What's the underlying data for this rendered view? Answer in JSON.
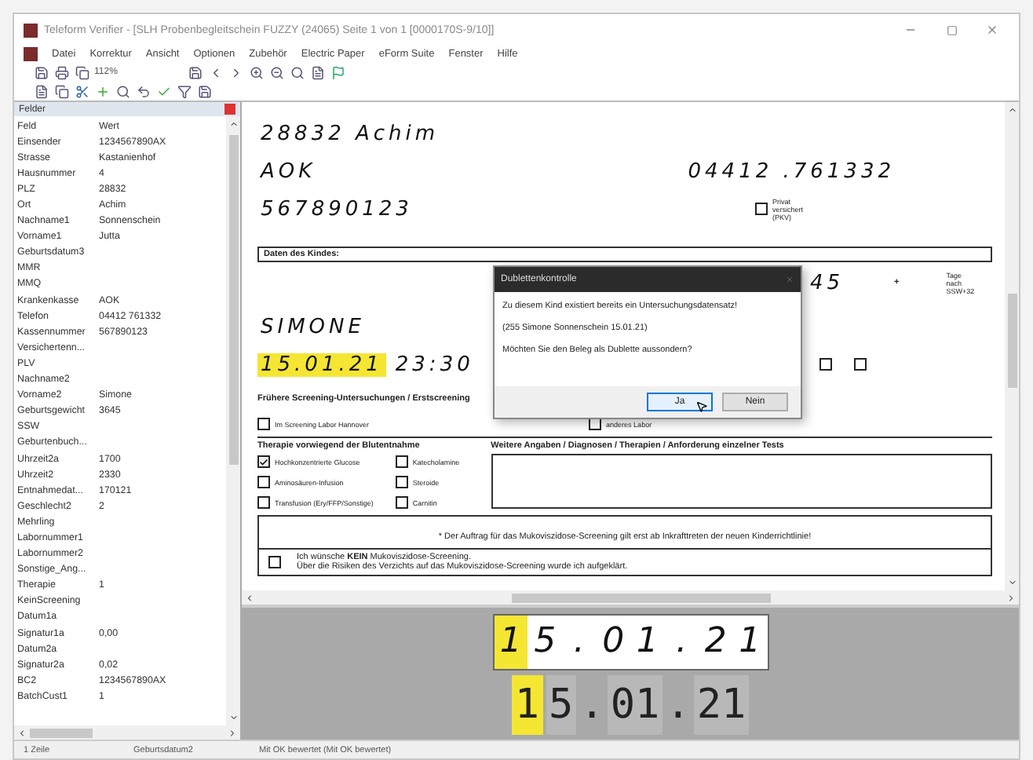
{
  "window": {
    "title": "Teleform Verifier - [SLH Probenbegleitschein FUZZY (24065) Seite 1 von 1 [0000170S-9/10]]"
  },
  "menu": [
    "Datei",
    "Korrektur",
    "Ansicht",
    "Optionen",
    "Zubehör",
    "Electric Paper",
    "eForm Suite",
    "Fenster",
    "Hilfe"
  ],
  "zoom": "112%",
  "fields_panel": {
    "title": "Felder",
    "columns": [
      "Feld",
      "Wert"
    ],
    "rows": [
      {
        "field": "Einsender",
        "value": "1234567890AX"
      },
      {
        "field": "Strasse",
        "value": "Kastanienhof"
      },
      {
        "field": "Hausnummer",
        "value": "4"
      },
      {
        "field": "PLZ",
        "value": "28832"
      },
      {
        "field": "Ort",
        "value": "Achim"
      },
      {
        "field": "Nachname1",
        "value": "Sonnenschein"
      },
      {
        "field": "Vorname1",
        "value": "Jutta"
      },
      {
        "field": "Geburtsdatum3"
      },
      {
        "field": "MMR"
      },
      {
        "field": "MMQ"
      },
      {
        "field": "Krankenkasse",
        "value": "AOK"
      },
      {
        "field": "Telefon",
        "value": "04412 761332"
      },
      {
        "field": "Kassennummer",
        "value": "567890123"
      },
      {
        "field": "Versichertenn..."
      },
      {
        "field": "PLV"
      },
      {
        "field": "Nachname2"
      },
      {
        "field": "Vorname2",
        "value": "Simone"
      },
      {
        "field": "Geburtsgewicht",
        "value": "3645"
      },
      {
        "field": "SSW"
      },
      {
        "field": "Geburtenbuch..."
      },
      {
        "field": "Uhrzeit2a",
        "value": "1700"
      },
      {
        "field": "Uhrzeit2",
        "value": "2330"
      },
      {
        "field": "Entnahmedat...",
        "value": "170121"
      },
      {
        "field": "Geschlecht2",
        "value": "2"
      },
      {
        "field": "Mehrling"
      },
      {
        "field": "Labornummer1"
      },
      {
        "field": "Labornummer2"
      },
      {
        "field": "Sonstige_Ang..."
      },
      {
        "field": "Therapie",
        "value": "1"
      },
      {
        "field": "KeinScreening"
      },
      {
        "field": "Datum1a"
      },
      {
        "field": "Signatur1a",
        "value": "0,00"
      },
      {
        "field": "Datum2a"
      },
      {
        "field": "Signatur2a",
        "value": "0,02"
      },
      {
        "field": "BC2",
        "value": "1234567890AX"
      },
      {
        "field": "BatchCust1",
        "value": "1"
      }
    ]
  },
  "form": {
    "city": "28832 Achim",
    "insurer": "AOK",
    "phone": "04412 .761332",
    "insurance_number": "567890123",
    "private": {
      "label": "Privat versichert (PKV)",
      "checked": false
    },
    "child_section": "Daten des Kindes:",
    "weight_tail": "45",
    "plus": "+",
    "days_label": "Tage nach SSW+32",
    "first_name": "SIMONE",
    "birth_date": "15.01.21",
    "birth_time": "23:30",
    "birth_checkboxes": [
      {
        "checked": false
      },
      {
        "checked": false
      }
    ],
    "earlier_heading": "Frühere Screening-Untersuchungen / Erstscreening",
    "earlier_options": [
      {
        "label": "Im Screening Labor Hannover",
        "checked": false
      },
      {
        "label": "anderes Labor",
        "checked": false
      }
    ],
    "therapy_heading": "Therapie vorwiegend der Blutentnahme",
    "therapies": [
      {
        "label": "Hochkonzentrierte Glucose",
        "checked": true
      },
      {
        "label": "Katecholamine",
        "checked": false
      },
      {
        "label": "Aminosäuren-Infusion",
        "checked": false
      },
      {
        "label": "Steroide",
        "checked": false
      },
      {
        "label": "Transfusion (Ery/FFP/Sonstige)",
        "checked": false
      },
      {
        "label": "Carnitin",
        "checked": false
      }
    ],
    "notes_heading": "Weitere Angaben / Diagnosen / Therapien / Anforderung einzelner Tests",
    "cf_notice": "* Der Auftrag für das Mukoviszidose-Screening gilt erst ab Inkrafttreten der neuen Kinderrichtlinie!",
    "cf_optout": {
      "checked": false,
      "lines": [
        "Ich wünsche **KEIN** Mukoviszidose-Screening.",
        "Über die Risiken des Verzichts auf das Mukoviszidose-Screening wurde ich aufgeklärt."
      ]
    }
  },
  "dialog": {
    "title": "Dublettenkontrolle",
    "lines": [
      "Zu diesem Kind existiert bereits ein Untersuchungsdatensatz!",
      "(255 Simone Sonnenschein 15.01.21)",
      "Möchten Sie den Beleg als Dublette aussondern?"
    ],
    "buttons": [
      {
        "label": "Ja",
        "default": true
      },
      {
        "label": "Nein",
        "default": false
      }
    ]
  },
  "preview": {
    "handwritten": [
      {
        "char": "1",
        "highlighted": true
      },
      {
        "char": "5",
        "highlighted": false
      },
      {
        "char": ".",
        "highlighted": false
      },
      {
        "char": "0",
        "highlighted": false
      },
      {
        "char": "1",
        "highlighted": false
      },
      {
        "char": ".",
        "highlighted": false
      },
      {
        "char": "2",
        "highlighted": false
      },
      {
        "char": "1",
        "highlighted": false
      }
    ],
    "recognized": [
      {
        "kind": "box",
        "text": "1",
        "highlighted": true
      },
      {
        "kind": "box",
        "text": "5",
        "highlighted": false
      },
      {
        "kind": "dot",
        "text": "."
      },
      {
        "kind": "box",
        "text": "01",
        "highlighted": false
      },
      {
        "kind": "dot",
        "text": "."
      },
      {
        "kind": "box",
        "text": "21",
        "highlighted": false
      }
    ]
  },
  "status_bar": {
    "count": "1 Zeile",
    "field": "Geburtsdatum2",
    "message": "Mit OK bewertet (Mit OK bewertet)"
  }
}
